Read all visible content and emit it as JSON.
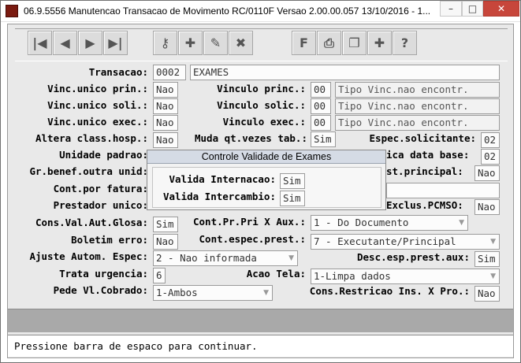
{
  "window": {
    "title": "06.9.5556 Manutencao  Transacao de Movimento RC/0110F Versao 2.00.00.057 13/10/2016 - 1...",
    "buttons": {
      "minimize": "–",
      "maximize": "□",
      "close": "✕"
    }
  },
  "toolbar": {
    "first": "|◀",
    "prev": "◀",
    "next": "▶",
    "last": "▶|",
    "t1": "⚷",
    "t2": "✚",
    "t3": "✎",
    "t4": "✖",
    "t5": "F",
    "t6": "⎙",
    "t7": "❐",
    "t8": "✚",
    "t9": "?"
  },
  "form": {
    "transacao": {
      "label": "Transacao:",
      "code": "0002",
      "name": "EXAMES"
    },
    "vinc_unico_prin": {
      "label": "Vinc.unico prin.:",
      "value": "Nao"
    },
    "vinculo_princ": {
      "label": "Vinculo princ.:",
      "code": "00",
      "desc": "Tipo Vinc.nao encontr."
    },
    "vinc_unico_soli": {
      "label": "Vinc.unico soli.:",
      "value": "Nao"
    },
    "vinculo_solic": {
      "label": "Vinculo solic.:",
      "code": "00",
      "desc": "Tipo Vinc.nao encontr."
    },
    "vinc_unico_exec": {
      "label": "Vinc.unico exec.:",
      "value": "Nao"
    },
    "vinculo_exec": {
      "label": "Vinculo exec.:",
      "code": "00",
      "desc": "Tipo Vinc.nao encontr."
    },
    "altera_class_hosp": {
      "label": "Altera class.hosp.:",
      "value": "Nao"
    },
    "muda_qt_vezes": {
      "label": "Muda qt.vezes tab.:",
      "value": "Sim"
    },
    "espec_solicitante": {
      "label": "Espec.solicitante:",
      "value": "02"
    },
    "unidade_padrao": {
      "label": "Unidade padrao:"
    },
    "ica_data_base": {
      "label": "ica data base:",
      "value": "02"
    },
    "gr_benef": {
      "label": "Gr.benef.outra unid:"
    },
    "st_principal": {
      "label": "st.principal:",
      "value": "Nao"
    },
    "cont_por_fatura": {
      "label": "Cont.por fatura:"
    },
    "prestador_unico": {
      "label": "Prestador unico:"
    },
    "exclus_pcmso": {
      "label": "Exclus.PCMSO:",
      "value": "Nao"
    },
    "cons_val_aut_glosa": {
      "label": "Cons.Val.Aut.Glosa:",
      "value": "Sim"
    },
    "cont_pr_pri_aux": {
      "label": "Cont.Pr.Pri X Aux.:",
      "value": "1 - Do Documento"
    },
    "boletim_erro": {
      "label": "Boletim erro:",
      "value": "Nao"
    },
    "cont_espec_prest": {
      "label": "Cont.espec.prest.:",
      "value": "7 - Executante/Principal"
    },
    "ajuste_autom_espec": {
      "label": "Ajuste Autom. Espec:",
      "value": "2 - Nao informada"
    },
    "desc_esp_prest_aux": {
      "label": "Desc.esp.prest.aux:",
      "value": "Sim"
    },
    "trata_urgencia": {
      "label": "Trata urgencia:",
      "value": "6"
    },
    "acao_tela": {
      "label": "Acao Tela:",
      "value": "1-Limpa dados"
    },
    "pede_vl_cobrado": {
      "label": "Pede Vl.Cobrado:",
      "value": "1-Ambos"
    },
    "cons_restricao": {
      "label": "Cons.Restricao Ins. X Pro.:",
      "value": "Nao"
    }
  },
  "dialog": {
    "title": "Controle Validade de Exames",
    "valida_internacao": {
      "label": "Valida Internacao:",
      "value": "Sim"
    },
    "valida_intercambio": {
      "label": "Valida Intercambio:",
      "value": "Sim"
    }
  },
  "status": {
    "message": "Pressione barra de espaco para continuar."
  }
}
